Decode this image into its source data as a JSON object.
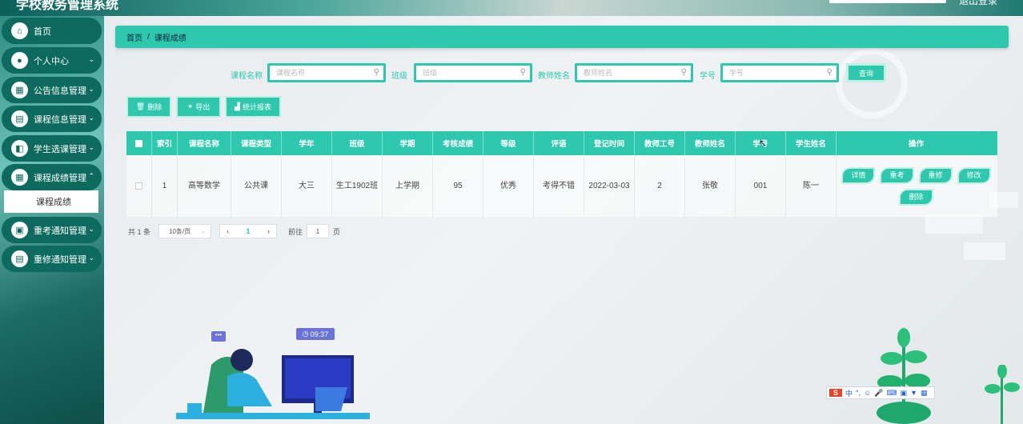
{
  "app": {
    "title": "学校教务管理系统",
    "logout": "退出登录"
  },
  "sidebar": {
    "items": [
      {
        "label": "首页",
        "icon": "home-icon",
        "glyph": "⌂",
        "has_children": false
      },
      {
        "label": "个人中心",
        "icon": "user-icon",
        "glyph": "●",
        "has_children": true
      },
      {
        "label": "公告信息管理",
        "icon": "grid-icon",
        "glyph": "▦",
        "has_children": true
      },
      {
        "label": "课程信息管理",
        "icon": "book-icon",
        "glyph": "▤",
        "has_children": true
      },
      {
        "label": "学生选课管理",
        "icon": "select-icon",
        "glyph": "◧",
        "has_children": true
      },
      {
        "label": "课程成绩管理",
        "icon": "score-icon",
        "glyph": "▦",
        "has_children": true
      },
      {
        "label": "重考通知管理",
        "icon": "clipboard-icon",
        "glyph": "▣",
        "has_children": true
      },
      {
        "label": "重修通知管理",
        "icon": "notice-icon",
        "glyph": "▤",
        "has_children": true
      }
    ],
    "active_sub": "课程成绩"
  },
  "breadcrumb": {
    "home": "首页",
    "sep": "/",
    "current": "课程成绩"
  },
  "search": {
    "fields": [
      {
        "label": "课程名称",
        "placeholder": "课程名称"
      },
      {
        "label": "班级",
        "placeholder": "班级"
      },
      {
        "label": "教师姓名",
        "placeholder": "教师姓名"
      },
      {
        "label": "学号",
        "placeholder": "学号"
      }
    ],
    "button": "查询"
  },
  "actions": {
    "delete": "删除",
    "export": "导出",
    "stats": "统计报表"
  },
  "table": {
    "headers": [
      "索引",
      "课程名称",
      "课程类型",
      "学年",
      "班级",
      "学期",
      "考核成绩",
      "等级",
      "评语",
      "登记时间",
      "教师工号",
      "教师姓名",
      "学号",
      "学生姓名",
      "操作"
    ],
    "row": {
      "index": "1",
      "course": "高等数学",
      "type": "公共课",
      "year": "大三",
      "class": "生工1902班",
      "term": "上学期",
      "score": "95",
      "grade": "优秀",
      "comment": "考得不错",
      "time": "2022-03-03",
      "teacher_id": "2",
      "teacher_name": "张敬",
      "student_id": "001",
      "student_name": "陈一"
    },
    "row_buttons": {
      "detail": "详情",
      "rexam": "重考",
      "retake": "重修",
      "edit": "修改",
      "delete": "删除"
    }
  },
  "pagination": {
    "total": "共 1 条",
    "page_size": "10条/页",
    "current": "1",
    "goto": "前往",
    "goto_value": "1",
    "page_unit": "页"
  },
  "decor": {
    "clock": "09:37"
  },
  "ime": {
    "logo": "S",
    "lang": "中"
  },
  "colors": {
    "accent": "#2ec8ae",
    "menu": "#0d6a5e"
  }
}
